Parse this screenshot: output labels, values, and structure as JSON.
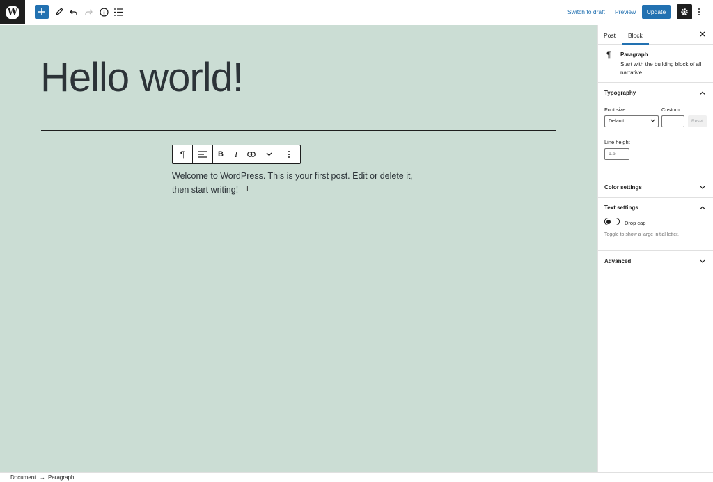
{
  "toolbar": {
    "switch_to_draft": "Switch to draft",
    "preview": "Preview",
    "update": "Update",
    "icons": [
      "wordpress-logo",
      "plus-icon",
      "pencil-icon",
      "undo-icon",
      "redo-icon",
      "info-icon",
      "list-view-icon",
      "gear-icon",
      "more-vertical-icon"
    ]
  },
  "editor": {
    "title": "Hello world!",
    "paragraph": "Welcome to WordPress. This is your first post. Edit or delete it, then start writing!",
    "block_toolbar_icons": [
      "pilcrow-icon",
      "align-left-icon",
      "bold-icon",
      "italic-icon",
      "link-icon",
      "chevron-down-icon",
      "more-vertical-icon"
    ],
    "bold_glyph": "B",
    "italic_glyph": "I"
  },
  "sidebar": {
    "tabs": {
      "post": "Post",
      "block": "Block",
      "active": "Block"
    },
    "block_card": {
      "name": "Paragraph",
      "description": "Start with the building block of all narrative."
    },
    "typography": {
      "title": "Typography",
      "expanded": true,
      "font_size_label": "Font size",
      "custom_label": "Custom",
      "font_size_value": "Default",
      "custom_value": "",
      "reset_label": "Reset",
      "line_height_label": "Line height",
      "line_height_placeholder": "1.5"
    },
    "color_settings": {
      "title": "Color settings",
      "expanded": false
    },
    "text_settings": {
      "title": "Text settings",
      "expanded": true,
      "drop_cap_label": "Drop cap",
      "drop_cap_on": false,
      "drop_cap_help": "Toggle to show a large initial letter."
    },
    "advanced": {
      "title": "Advanced",
      "expanded": false
    }
  },
  "footer": {
    "breadcrumb": [
      "Document",
      "Paragraph"
    ]
  },
  "colors": {
    "accent": "#2271b1",
    "canvas_bg": "#cbddd4",
    "dark": "#1e1e1e"
  }
}
